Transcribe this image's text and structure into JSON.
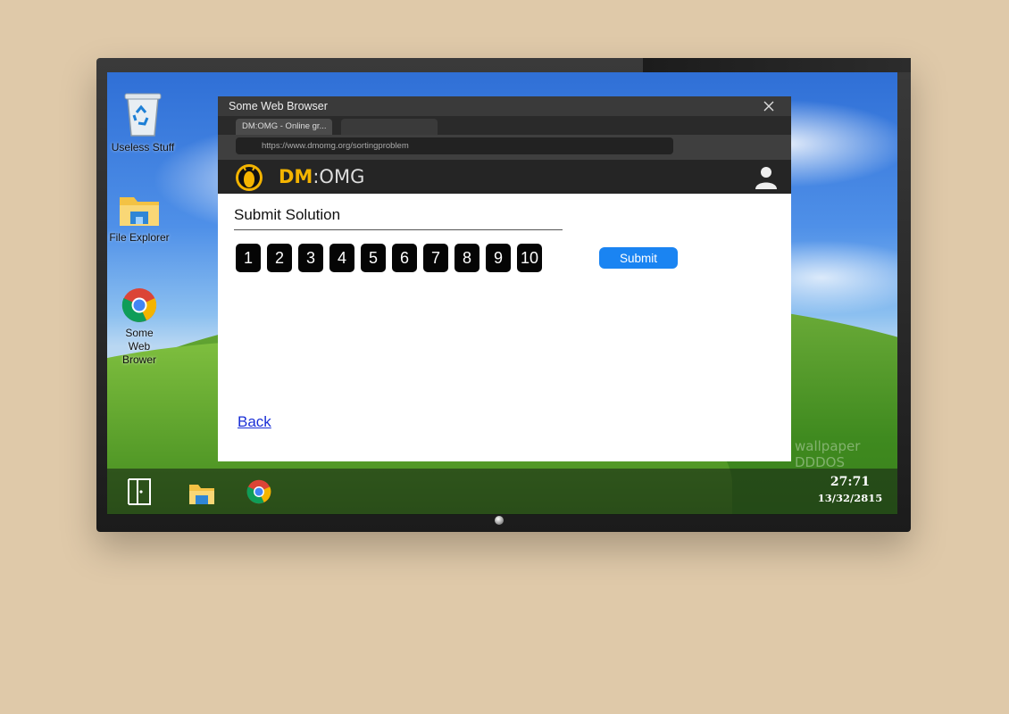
{
  "desktop": {
    "icons": [
      {
        "label": "Useless Stuff",
        "icon": "recycle-bin-icon"
      },
      {
        "label": "File Explorer",
        "icon": "folder-icon"
      },
      {
        "label": "Some Web Brower",
        "icon": "chrome-icon"
      }
    ],
    "watermark": "wallpaper DDDOS"
  },
  "browser": {
    "window_title": "Some Web Browser",
    "tabs": [
      {
        "label": "DM:OMG - Online gr..."
      },
      {
        "label": ""
      }
    ],
    "url": "https://www.dmomg.org/sortingproblem"
  },
  "site": {
    "brand_part1": "DM",
    "brand_part2": ":OMG",
    "page_title": "Submit Solution",
    "numbers": [
      "1",
      "2",
      "3",
      "4",
      "5",
      "6",
      "7",
      "8",
      "9",
      "10"
    ],
    "submit_label": "Submit",
    "back_label": "Back",
    "accent_color": "#f4b400",
    "button_color": "#1a84f2"
  },
  "taskbar": {
    "items": [
      "door-icon",
      "folder-icon",
      "chrome-icon"
    ],
    "time": "27:71",
    "date": "13/32/2815"
  }
}
